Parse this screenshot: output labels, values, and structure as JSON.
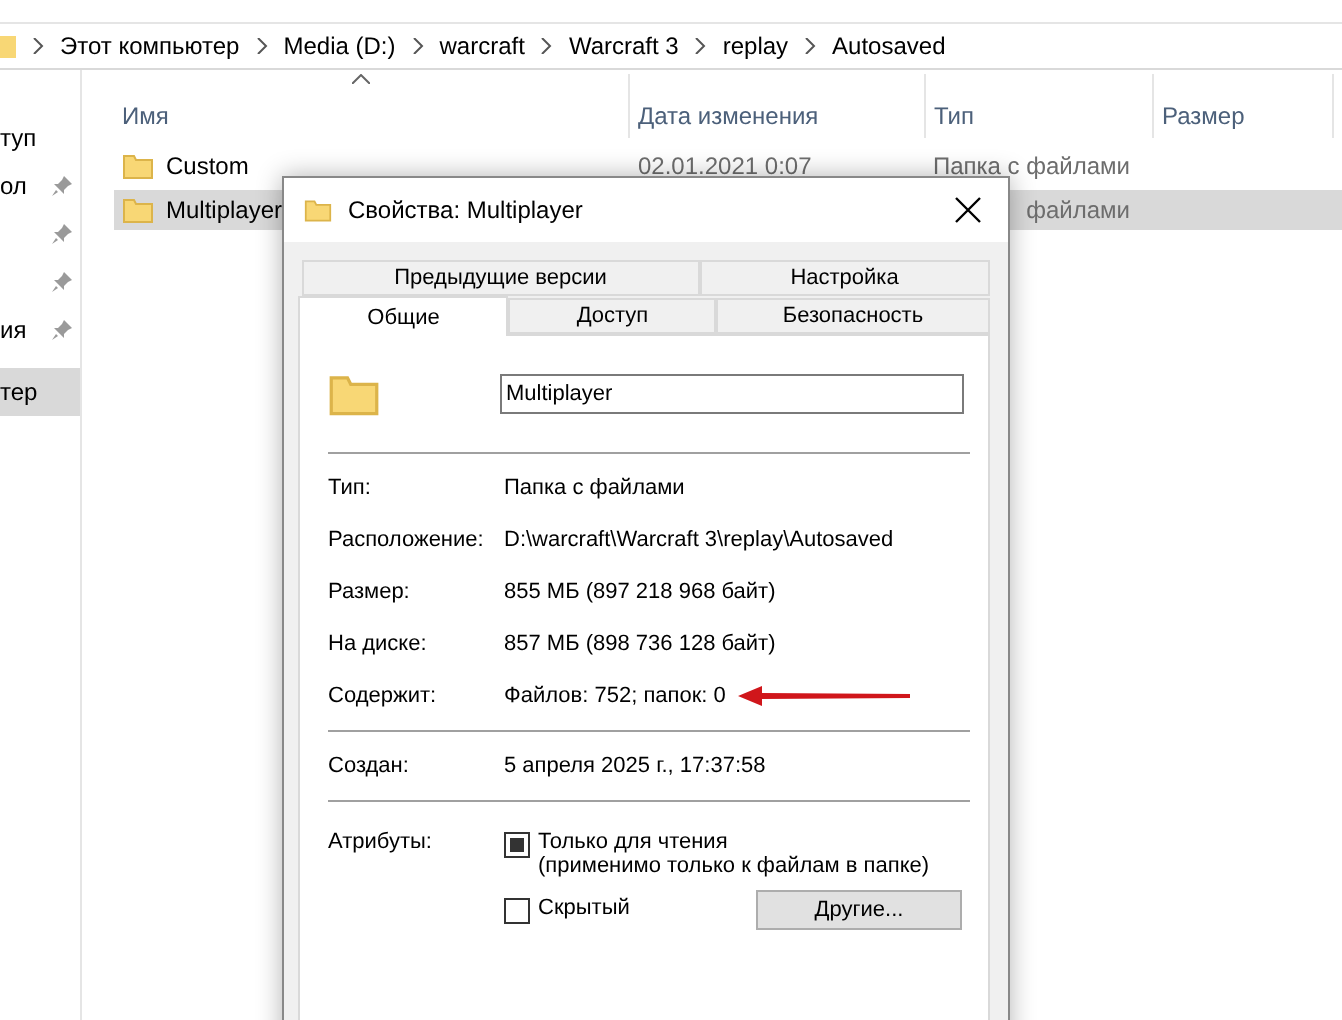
{
  "address_bar": {
    "crumbs": [
      "Этот компьютер",
      "Media (D:)",
      "warcraft",
      "Warcraft 3",
      "replay",
      "Autosaved"
    ]
  },
  "nav_pane": {
    "items": [
      {
        "label": "туп",
        "pinned": false,
        "selected": false
      },
      {
        "label": "ол",
        "pinned": true,
        "selected": false
      },
      {
        "pinned": true,
        "selected": false
      },
      {
        "pinned": true,
        "selected": false
      },
      {
        "label": "ия",
        "pinned": true,
        "selected": false
      },
      {
        "label": "тер",
        "pinned": false,
        "selected": true
      }
    ]
  },
  "file_list": {
    "columns": [
      {
        "label": "Имя",
        "sorted": true
      },
      {
        "label": "Дата изменения",
        "sorted": false
      },
      {
        "label": "Тип",
        "sorted": false
      },
      {
        "label": "Размер",
        "sorted": false
      }
    ],
    "rows": [
      {
        "name": "Custom",
        "date": "02.01.2021 0:07",
        "type": "Папка с файлами",
        "selected": false
      },
      {
        "name": "Multiplayer",
        "type": "файлами",
        "selected": true
      }
    ]
  },
  "dialog": {
    "title": "Свойства: Multiplayer",
    "tab_rows": [
      [
        {
          "label": "Предыдущие версии",
          "selected": false
        },
        {
          "label": "Настройка",
          "selected": false
        }
      ],
      [
        {
          "label": "Общие",
          "selected": true
        },
        {
          "label": "Доступ",
          "selected": false
        },
        {
          "label": "Безопасность",
          "selected": false
        }
      ]
    ],
    "name_field": {
      "value": "Multiplayer"
    },
    "groups": [
      [
        {
          "label": "Тип:",
          "value": "Папка с файлами",
          "annotated": false
        },
        {
          "label": "Расположение:",
          "value": "D:\\warcraft\\Warcraft 3\\replay\\Autosaved",
          "annotated": false
        },
        {
          "label": "Размер:",
          "value": "855 МБ (897 218 968 байт)",
          "annotated": false
        },
        {
          "label": "На диске:",
          "value": "857 МБ (898 736 128 байт)",
          "annotated": false
        },
        {
          "label": "Содержит:",
          "value": "Файлов: 752; папок: 0",
          "annotated": true
        }
      ],
      [
        {
          "label": "Создан:",
          "value": "5 апреля 2025 г., 17:37:58",
          "annotated": false
        }
      ]
    ],
    "attributes": {
      "label": "Атрибуты:",
      "items": [
        {
          "label": "Только для чтения",
          "note": "(применимо только к файлам в папке)",
          "indeterminate": true
        },
        {
          "label": "Скрытый",
          "indeterminate": false
        }
      ],
      "button": "Другие..."
    }
  }
}
